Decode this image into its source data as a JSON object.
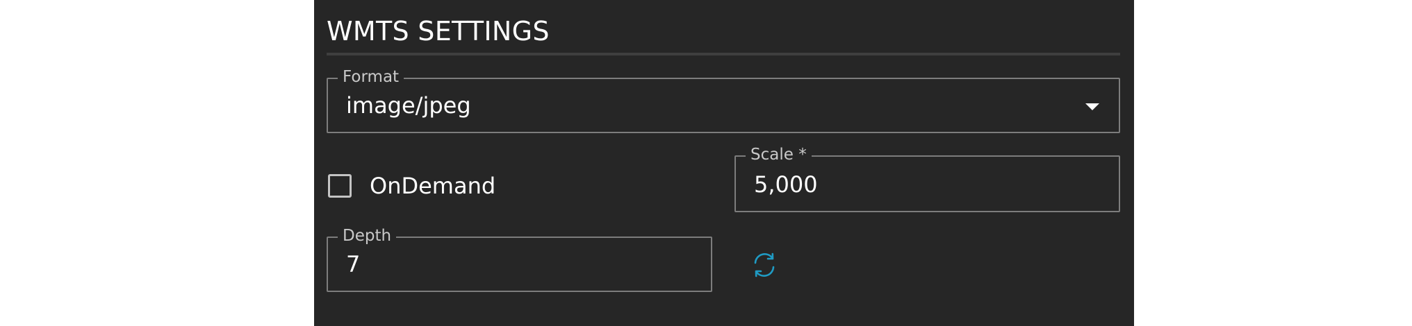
{
  "panel": {
    "title": "WMTS SETTINGS"
  },
  "format": {
    "label": "Format",
    "value": "image/jpeg",
    "dropdown_icon": "caret-down-icon"
  },
  "on_demand": {
    "label": "OnDemand",
    "checked": false
  },
  "scale": {
    "label": "Scale *",
    "value": "5,000"
  },
  "depth": {
    "label": "Depth",
    "value": "7"
  },
  "refresh": {
    "icon": "refresh-icon"
  },
  "colors": {
    "panel_background": "#262626",
    "page_background": "#ffffff",
    "text": "#ffffff",
    "legend_text": "#c9c9c9",
    "field_border": "#7d7d7d",
    "accent": "#1f9bc4"
  }
}
